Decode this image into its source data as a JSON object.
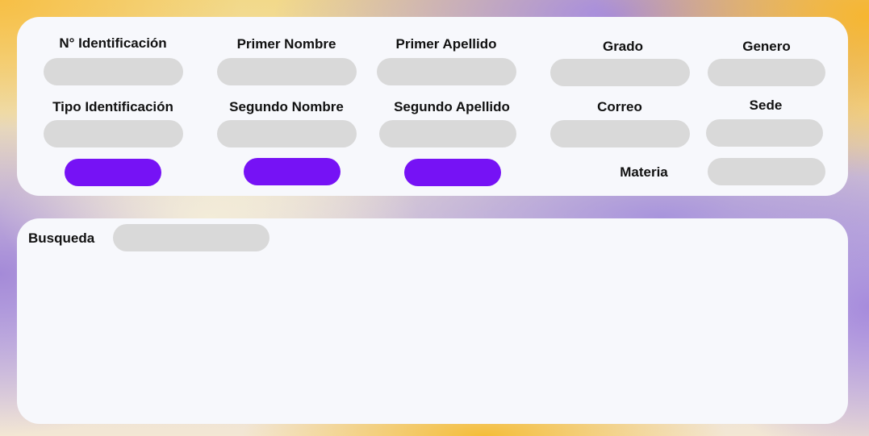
{
  "form": {
    "labels": {
      "id_number": "N° Identificación",
      "first_name": "Primer Nombre",
      "first_surname": "Primer Apellido",
      "grade": "Grado",
      "gender": "Genero",
      "id_type": "Tipo Identificación",
      "second_name": "Segundo Nombre",
      "second_surname": "Segundo Apellido",
      "email": "Correo",
      "campus": "Sede",
      "subject": "Materia"
    },
    "values": {
      "id_number": "",
      "first_name": "",
      "first_surname": "",
      "grade": "",
      "gender": "",
      "id_type": "",
      "second_name": "",
      "second_surname": "",
      "email": "",
      "campus": "",
      "subject": ""
    },
    "buttons": {
      "button_1": "",
      "button_2": "",
      "button_3": ""
    }
  },
  "search": {
    "label": "Busqueda",
    "value": ""
  },
  "colors": {
    "panel_bg": "#f7f8fc",
    "field_bg": "#d9d9d9",
    "button_bg": "#7612f5"
  }
}
